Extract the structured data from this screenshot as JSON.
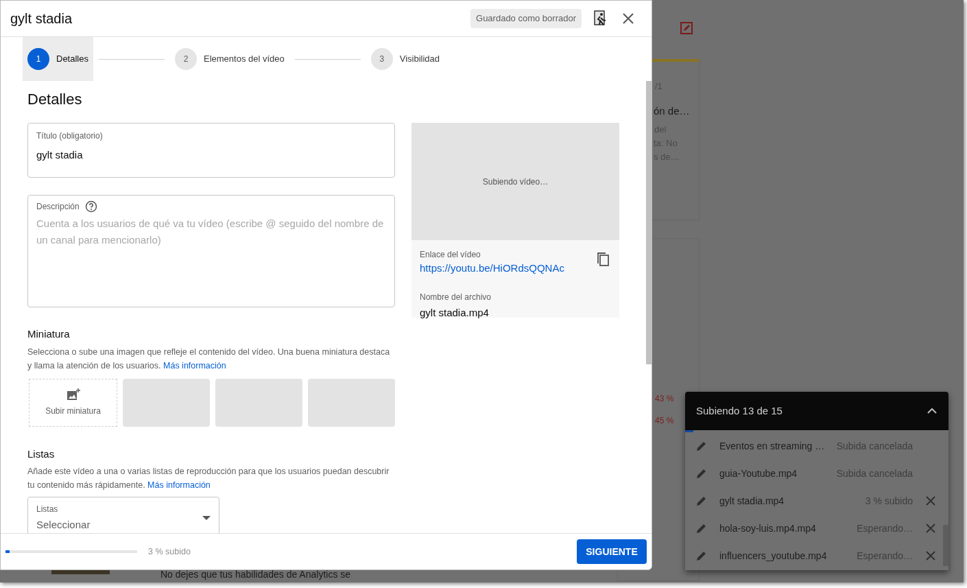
{
  "background": {
    "fragments": [
      {
        "kind": "muted",
        "text": "/1"
      },
      {
        "kind": "title",
        "text": "ón de…"
      },
      {
        "kind": "muted",
        "text": "del"
      },
      {
        "kind": "muted",
        "text": "ta: No"
      },
      {
        "kind": "muted",
        "text": "s de…"
      },
      {
        "kind": "alert",
        "text": "43 %"
      },
      {
        "kind": "alert",
        "text": "45 %"
      },
      {
        "kind": "body",
        "text": "No dejes que tus habilidades de Analytics se"
      }
    ]
  },
  "dialog": {
    "title": "gylt stadia",
    "draft_badge": "Guardado como borrador",
    "steps": [
      {
        "number": "1",
        "label": "Detalles",
        "selected": true
      },
      {
        "number": "2",
        "label": "Elementos del vídeo",
        "selected": false
      },
      {
        "number": "3",
        "label": "Visibilidad",
        "selected": false
      }
    ],
    "heading": "Detalles",
    "title_field": {
      "label": "Título (obligatorio)",
      "value": "gylt stadia"
    },
    "description_field": {
      "label": "Descripción",
      "placeholder": "Cuenta a los usuarios de qué va tu vídeo (escribe @ seguido del nombre de un canal para mencionarlo)"
    },
    "preview": {
      "status": "Subiendo vídeo…",
      "link_label": "Enlace del vídeo",
      "link": "https://youtu.be/HiORdsQQNAc",
      "filename_label": "Nombre del archivo",
      "filename": "gylt stadia.mp4"
    },
    "thumbnail": {
      "heading": "Miniatura",
      "text": "Selecciona o sube una imagen que refleje el contenido del vídeo. Una buena miniatura destaca y llama la atención de los usuarios.",
      "link": "Más información",
      "upload_label": "Subir miniatura"
    },
    "playlists": {
      "heading": "Listas",
      "text": "Añade este vídeo a una o varias listas de reproducción para que los usuarios puedan descubrir tu contenido más rápidamente.",
      "link": "Más información",
      "select": {
        "label": "Listas",
        "value": "Seleccionar"
      }
    },
    "footer": {
      "progress": {
        "level": 0.03
      },
      "status": "3 % subido",
      "next_button": "SIGUIENTE"
    }
  },
  "uploads_panel": {
    "title": "Subiendo 13 de 15",
    "progress": {
      "level": 0.03
    },
    "items": [
      {
        "name": "Eventos en streaming …",
        "status": "Subida cancelada",
        "cancellable": false
      },
      {
        "name": "guia-Youtube.mp4",
        "status": "Subida cancelada",
        "cancellable": false
      },
      {
        "name": "gylt stadia.mp4",
        "status": "3 % subido",
        "cancellable": true
      },
      {
        "name": "hola-soy-luis.mp4.mp4",
        "status": "Esperando…",
        "cancellable": true
      },
      {
        "name": "influencers_youtube.mp4",
        "status": "Esperando…",
        "cancellable": true
      }
    ]
  }
}
